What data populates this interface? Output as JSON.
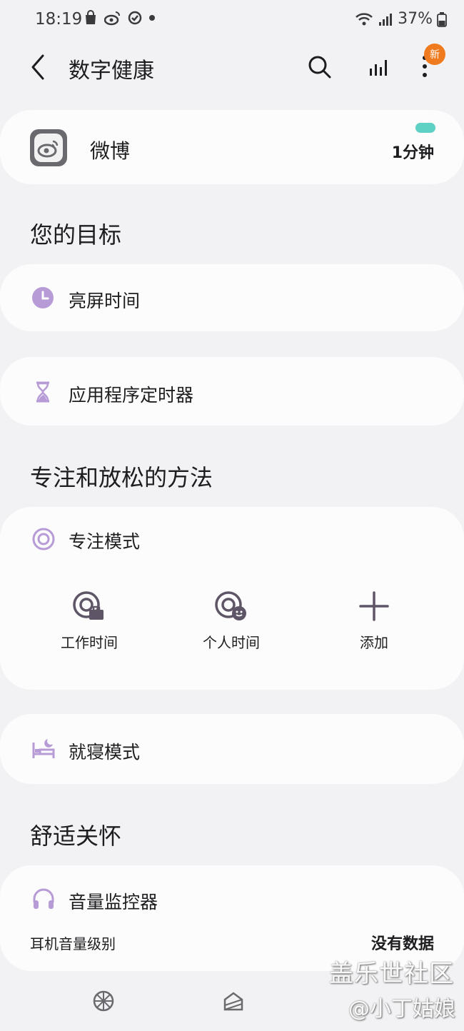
{
  "status_bar": {
    "time": "18:19",
    "battery": "37%"
  },
  "header": {
    "title": "数字健康",
    "badge": "新"
  },
  "app_usage": {
    "app_name": "微博",
    "usage_time": "1分钟"
  },
  "goals": {
    "section_title": "您的目标",
    "screen_time": "亮屏时间",
    "app_timer": "应用程序定时器"
  },
  "focus": {
    "section_title": "专注和放松的方法",
    "focus_mode": "专注模式",
    "items": [
      {
        "label": "工作时间"
      },
      {
        "label": "个人时间"
      },
      {
        "label": "添加"
      }
    ],
    "bedtime_mode": "就寝模式"
  },
  "wellbeing": {
    "section_title": "舒适关怀",
    "volume_monitor": "音量监控器",
    "headphone_level_label": "耳机音量级别",
    "headphone_level_value": "没有数据"
  },
  "watermark": {
    "line1": "盖乐世社区",
    "line2": "@小丁姑娘"
  },
  "colors": {
    "accent": "#b79bd6",
    "icon_dark": "#5e5566",
    "usage_bar": "#5fd1c4",
    "badge": "#f07a1e"
  }
}
